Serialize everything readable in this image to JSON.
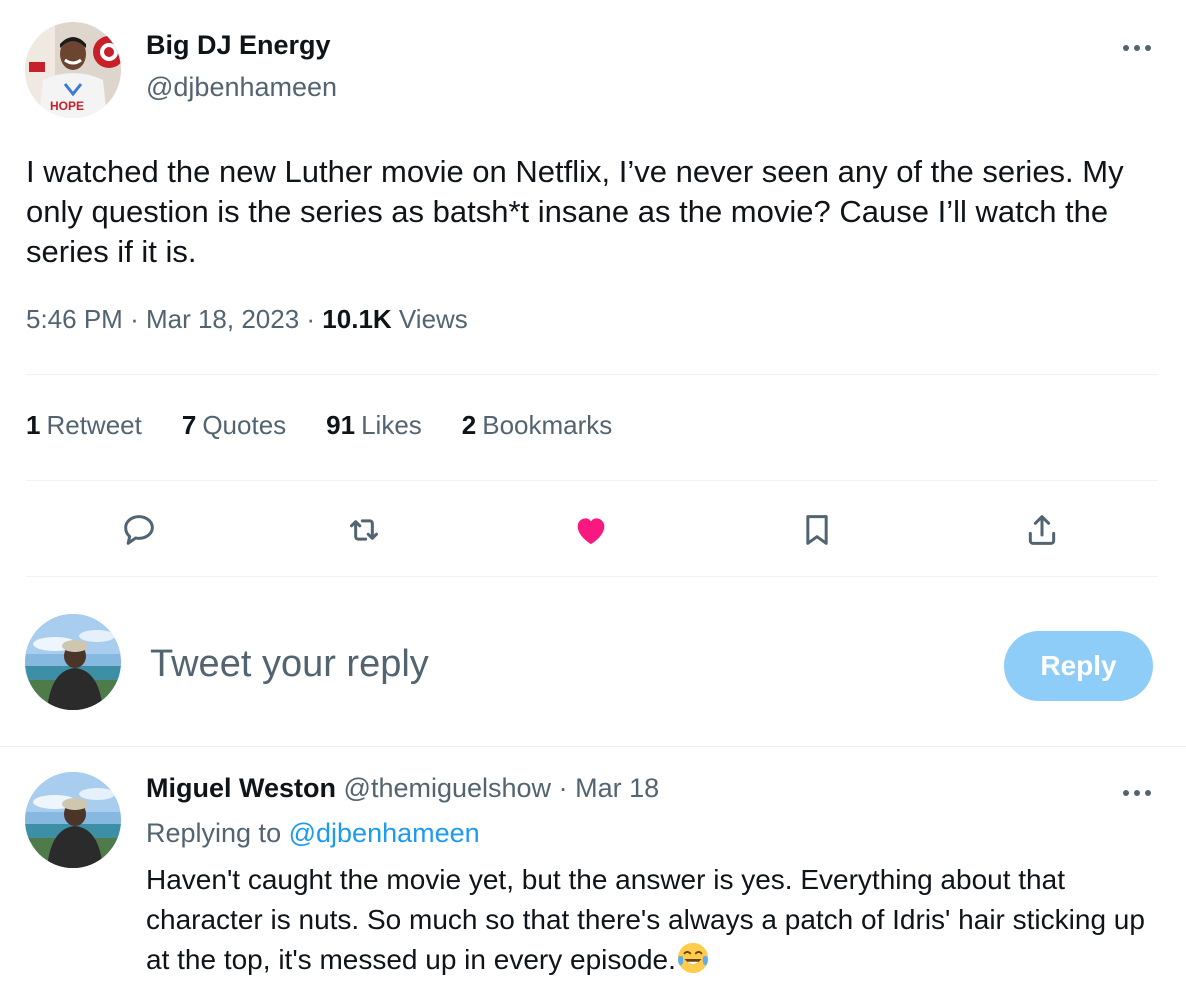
{
  "tweet": {
    "author_name": "Big DJ Energy",
    "author_handle": "@djbenhameen",
    "avatar_shirt_text": "HOPE",
    "text": "I watched the new Luther movie on Netflix, I’ve never seen any of the series. My only question is the series as batsh*t insane as the movie? Cause I’ll watch the series if it is.",
    "time": "5:46 PM",
    "date": "Mar 18, 2023",
    "views_count": "10.1K",
    "views_label": "Views",
    "stats": {
      "retweets_count": "1",
      "retweets_label": "Retweet",
      "quotes_count": "7",
      "quotes_label": "Quotes",
      "likes_count": "91",
      "likes_label": "Likes",
      "bookmarks_count": "2",
      "bookmarks_label": "Bookmarks"
    },
    "liked": true,
    "actions": [
      "reply-icon",
      "retweet-icon",
      "heart-icon",
      "bookmark-icon",
      "share-icon"
    ]
  },
  "composer": {
    "placeholder": "Tweet your reply",
    "button_label": "Reply"
  },
  "reply": {
    "author_name": "Miguel Weston",
    "author_handle": "@themiguelshow",
    "separator": "·",
    "date": "Mar 18",
    "replying_to_label": "Replying to",
    "replying_to_handle": "@djbenhameen",
    "text": "Haven't caught the movie yet, but the answer is yes. Everything about that character is nuts. So much so that there's always a patch of Idris' hair sticking up at the top, it's messed up in every episode.",
    "emoji": "face-with-tears-of-joy-emoji"
  },
  "colors": {
    "text_primary": "#0f1419",
    "text_secondary": "#536471",
    "accent": "#1d9bf0",
    "like": "#f91880",
    "reply_button_disabled": "#8ecdf8",
    "divider": "#eff3f4"
  }
}
